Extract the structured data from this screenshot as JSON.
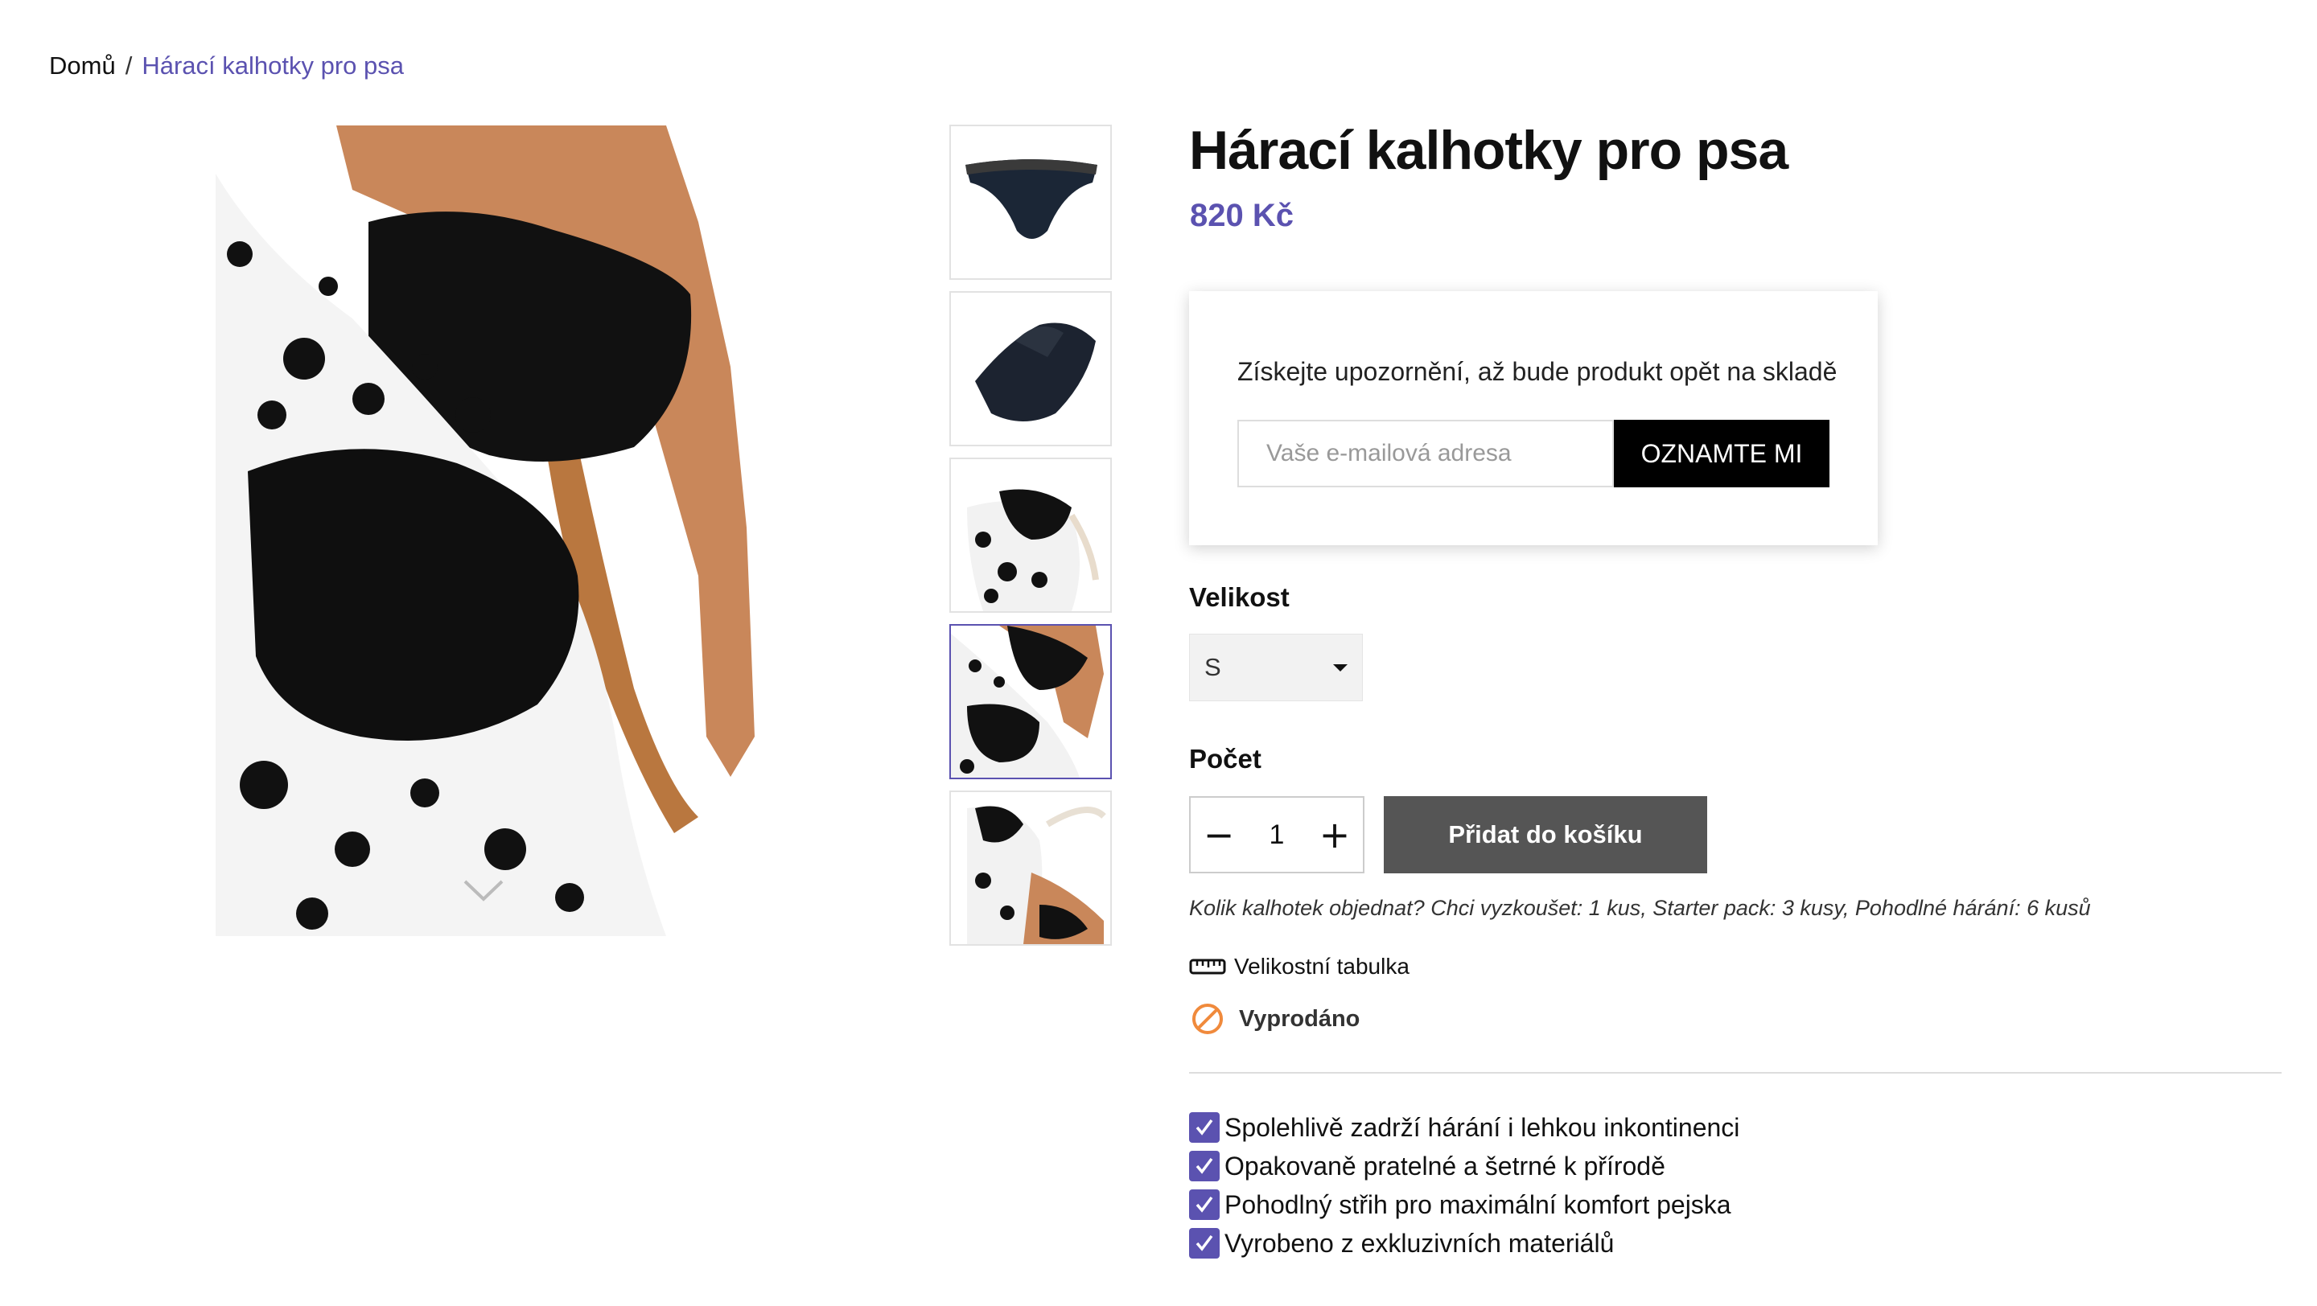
{
  "breadcrumb": {
    "home": "Domů",
    "separator": "/",
    "current": "Hárací kalhotky pro psa"
  },
  "product": {
    "title": "Hárací kalhotky pro psa",
    "price": "820 Kč"
  },
  "notify": {
    "text": "Získejte upozornění, až bude produkt opět na skladě",
    "email_placeholder": "Vaše e-mailová adresa",
    "button_label": "OZNAMTE MI"
  },
  "size": {
    "label": "Velikost",
    "selected": "S"
  },
  "quantity": {
    "label": "Počet",
    "value": "1",
    "minus": "−",
    "plus": "+"
  },
  "add_to_cart_label": "Přidat do košíku",
  "hint": "Kolik kalhotek objednat? Chci vyzkoušet: 1 kus, Starter pack: 3 kusy, Pohodlné hárání: 6 kusů",
  "size_chart_label": "Velikostní tabulka",
  "stock_status": "Vyprodáno",
  "features": [
    "Spolehlivě zadrží hárání i lehkou inkontinenci",
    "Opakovaně pratelné a šetrné k přírodě",
    "Pohodlný střih pro maximální komfort pejska",
    "Vyrobeno z exkluzivních materiálů"
  ],
  "thumbnails": {
    "count": 5,
    "active_index": 3
  },
  "colors": {
    "accent": "#5b52b0",
    "button_dark": "#000000",
    "button_disabled": "#555555",
    "soldout": "#f08a3c"
  },
  "icons": [
    "chevron-down-icon",
    "ruler-icon",
    "soldout-icon",
    "check-icon",
    "caret-down-icon"
  ]
}
